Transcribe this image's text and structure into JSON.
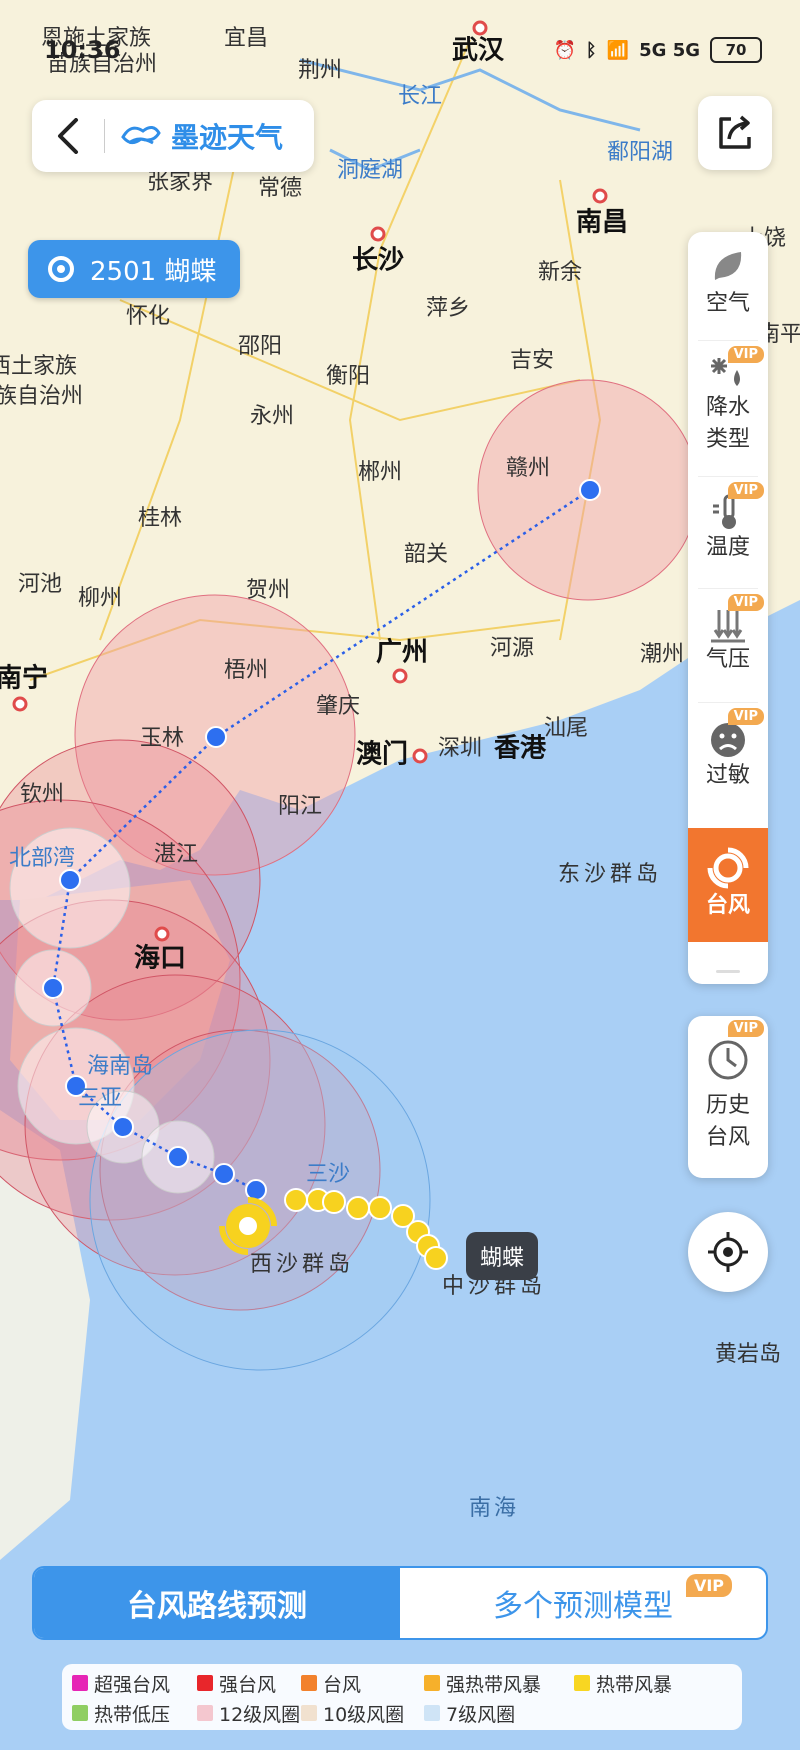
{
  "status_bar": {
    "time": "10:36",
    "signal": "5G 5G",
    "battery": "70"
  },
  "header": {
    "brand": "墨迹天气"
  },
  "typhoon_badge": {
    "label": "2501 蝴蝶"
  },
  "side_panel": {
    "items": [
      {
        "label": "空气",
        "vip": ""
      },
      {
        "label": "降水\n类型",
        "vip": "VIP"
      },
      {
        "label": "温度",
        "vip": "VIP"
      },
      {
        "label": "气压",
        "vip": "VIP"
      },
      {
        "label": "过敏",
        "vip": "VIP"
      },
      {
        "label": "台风",
        "vip": ""
      }
    ],
    "history": {
      "label": "历史\n台风",
      "vip": "VIP"
    }
  },
  "typhoon_label": "蝴蝶",
  "map_labels": [
    {
      "text": "恩施土家族",
      "cls": ""
    },
    {
      "text": "苗族自治州",
      "cls": ""
    },
    {
      "text": "宜昌",
      "cls": ""
    },
    {
      "text": "荆州",
      "cls": ""
    },
    {
      "text": "武汉",
      "cls": "major"
    },
    {
      "text": "长江",
      "cls": "water"
    },
    {
      "text": "鄱阳湖",
      "cls": "water"
    },
    {
      "text": "张家界",
      "cls": ""
    },
    {
      "text": "常德",
      "cls": ""
    },
    {
      "text": "洞庭湖",
      "cls": "water"
    },
    {
      "text": "南昌",
      "cls": "major"
    },
    {
      "text": "上饶",
      "cls": ""
    },
    {
      "text": "长沙",
      "cls": "major"
    },
    {
      "text": "新余",
      "cls": ""
    },
    {
      "text": "怀化",
      "cls": ""
    },
    {
      "text": "萍乡",
      "cls": ""
    },
    {
      "text": "邵阳",
      "cls": ""
    },
    {
      "text": "湘西土家族",
      "cls": ""
    },
    {
      "text": "苗族自治州",
      "cls": ""
    },
    {
      "text": "衡阳",
      "cls": ""
    },
    {
      "text": "吉安",
      "cls": ""
    },
    {
      "text": "南平",
      "cls": ""
    },
    {
      "text": "永州",
      "cls": ""
    },
    {
      "text": "赣州",
      "cls": ""
    },
    {
      "text": "郴州",
      "cls": ""
    },
    {
      "text": "桂林",
      "cls": ""
    },
    {
      "text": "韶关",
      "cls": ""
    },
    {
      "text": "河池",
      "cls": ""
    },
    {
      "text": "柳州",
      "cls": ""
    },
    {
      "text": "贺州",
      "cls": ""
    },
    {
      "text": "广州",
      "cls": "major"
    },
    {
      "text": "河源",
      "cls": ""
    },
    {
      "text": "潮州",
      "cls": ""
    },
    {
      "text": "梧州",
      "cls": ""
    },
    {
      "text": "南宁",
      "cls": "major"
    },
    {
      "text": "肇庆",
      "cls": ""
    },
    {
      "text": "汕尾",
      "cls": ""
    },
    {
      "text": "玉林",
      "cls": ""
    },
    {
      "text": "澳门",
      "cls": "major"
    },
    {
      "text": "深圳",
      "cls": ""
    },
    {
      "text": "香港",
      "cls": "major"
    },
    {
      "text": "钦州",
      "cls": ""
    },
    {
      "text": "阳江",
      "cls": ""
    },
    {
      "text": "北部湾",
      "cls": "water"
    },
    {
      "text": "湛江",
      "cls": ""
    },
    {
      "text": "东沙群岛",
      "cls": "island"
    },
    {
      "text": "海口",
      "cls": "major"
    },
    {
      "text": "海南岛",
      "cls": "water"
    },
    {
      "text": "三亚",
      "cls": "water"
    },
    {
      "text": "三沙",
      "cls": "water"
    },
    {
      "text": "西沙群岛",
      "cls": "island"
    },
    {
      "text": "中沙群岛",
      "cls": "island"
    },
    {
      "text": "黄岩岛",
      "cls": ""
    },
    {
      "text": "南海",
      "cls": "sea"
    }
  ],
  "tabs": [
    {
      "label": "台风路线预测",
      "active": true
    },
    {
      "label": "多个预测模型",
      "active": false,
      "vip": "VIP"
    }
  ],
  "legend": [
    {
      "label": "超强台风",
      "color": "#e625b6"
    },
    {
      "label": "强台风",
      "color": "#e8262b"
    },
    {
      "label": "台风",
      "color": "#f2812c"
    },
    {
      "label": "强热带风暴",
      "color": "#f6b02b"
    },
    {
      "label": "热带风暴",
      "color": "#f8d622"
    },
    {
      "label": "热带低压",
      "color": "#8fce63"
    },
    {
      "label": "12级风圈",
      "color": "#f4c7cf"
    },
    {
      "label": "10级风圈",
      "color": "#f1e1cf"
    },
    {
      "label": "7级风圈",
      "color": "#cfe4f6"
    }
  ]
}
